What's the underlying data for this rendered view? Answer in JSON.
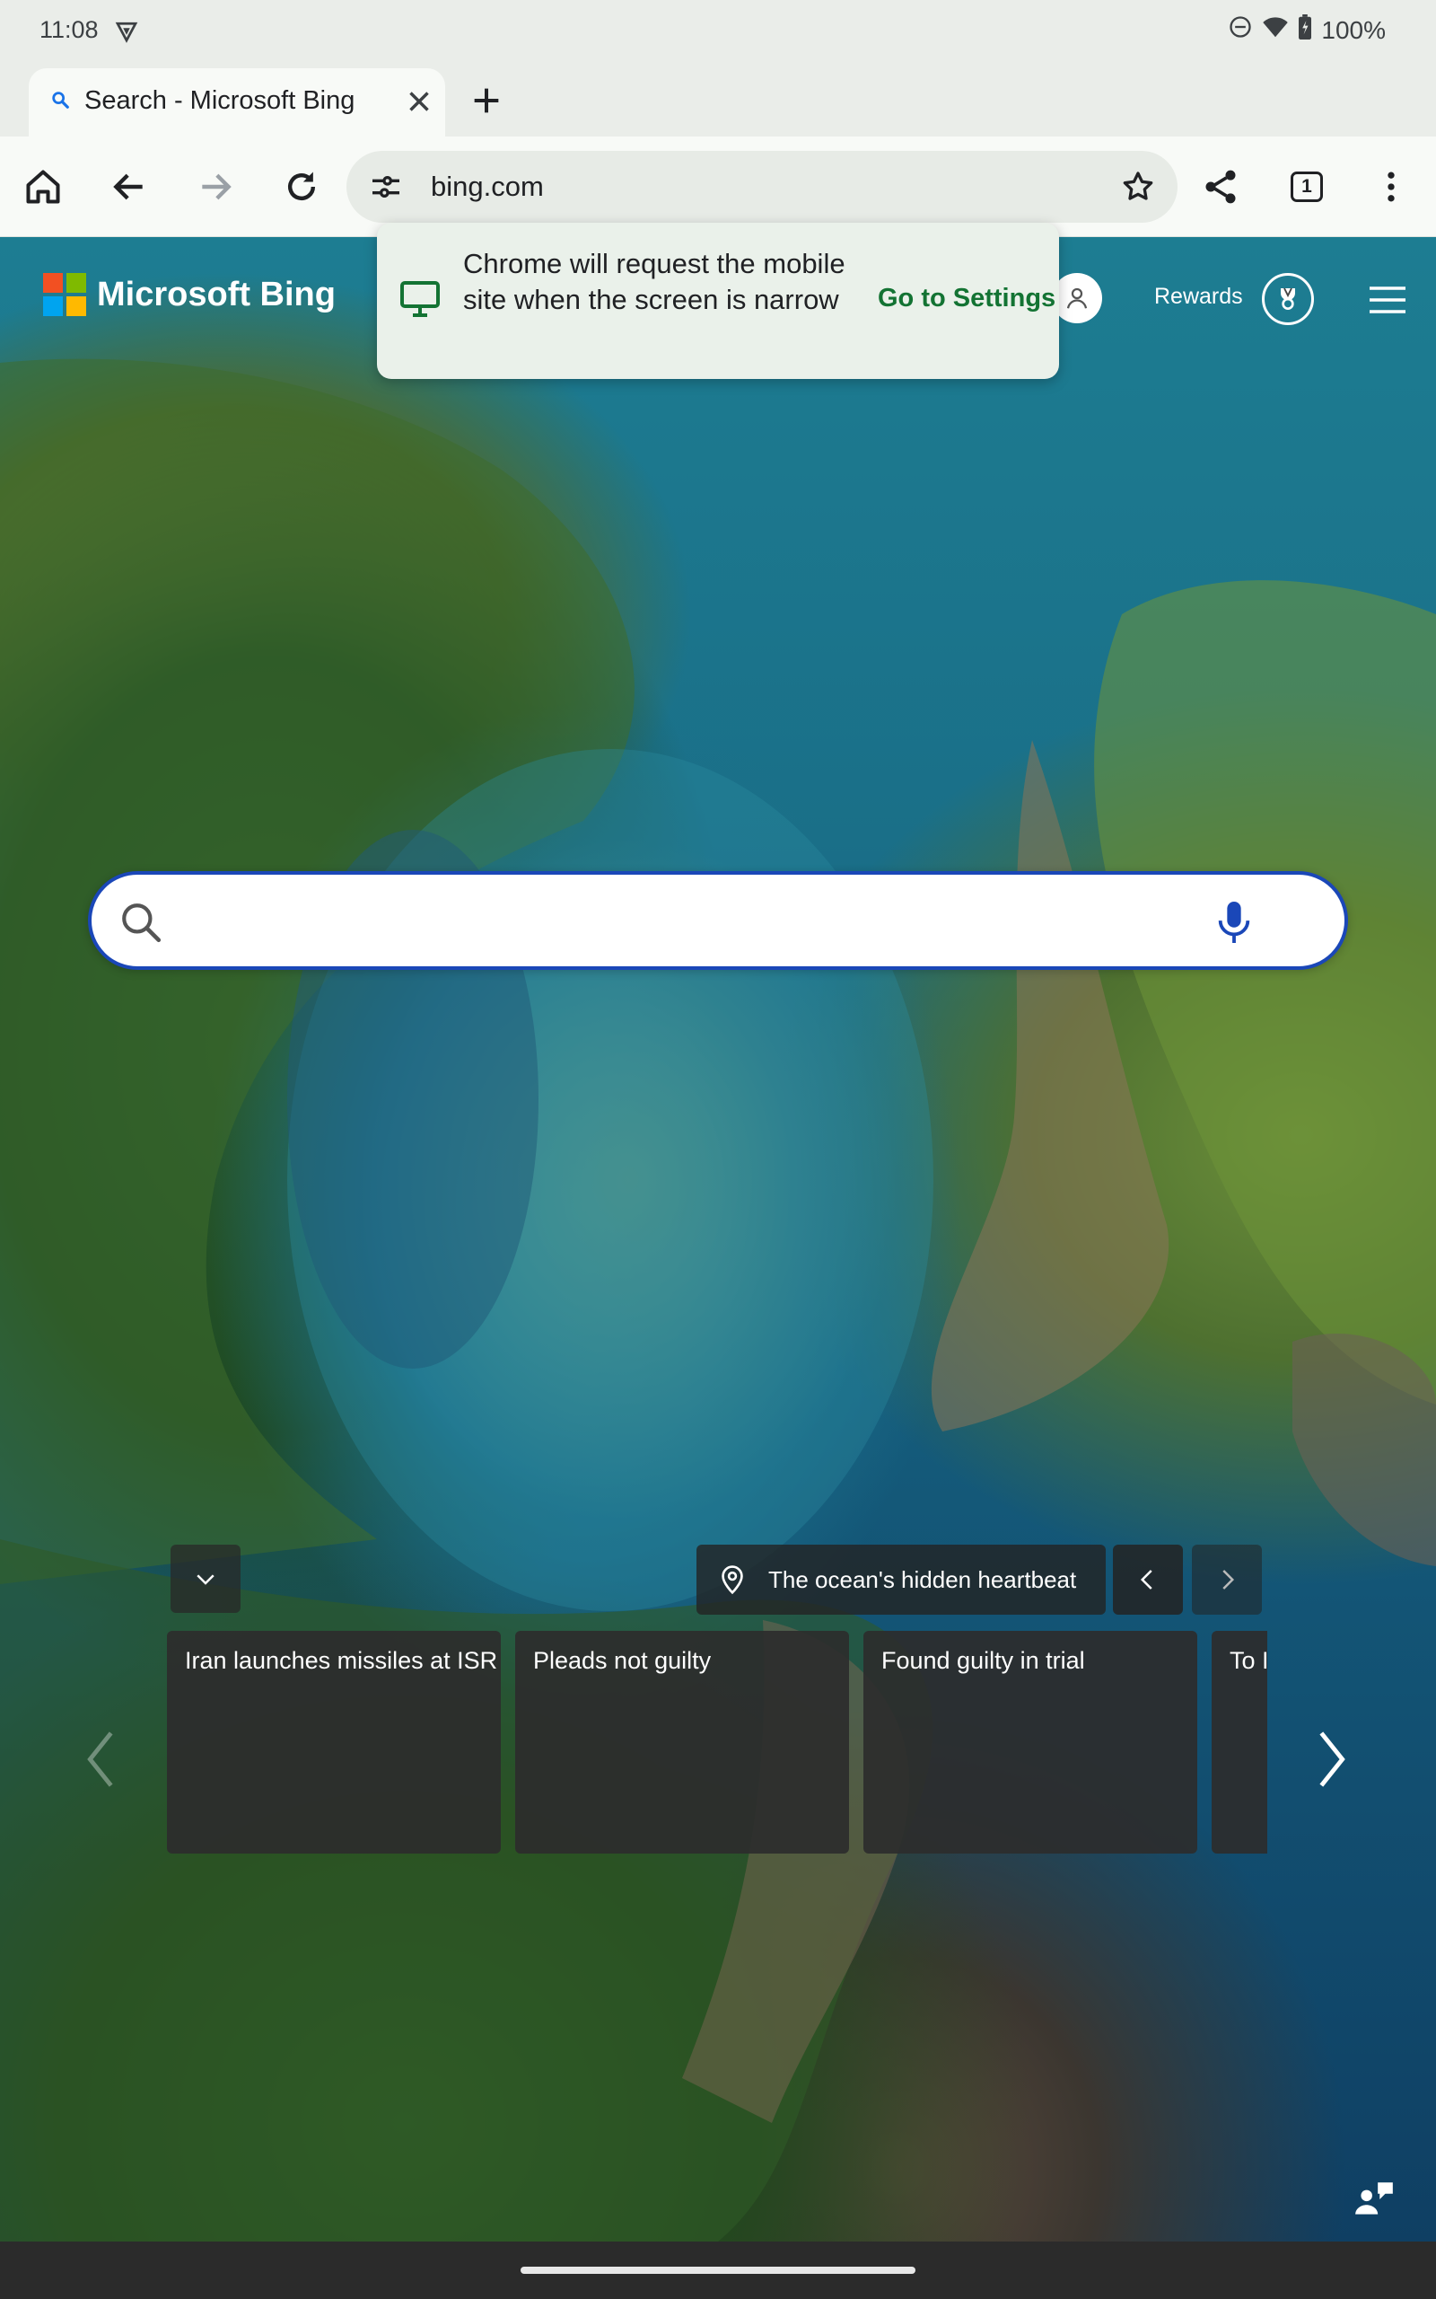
{
  "status": {
    "time": "11:08",
    "battery": "100%"
  },
  "tab": {
    "title": "Search - Microsoft Bing",
    "count": "1"
  },
  "omnibox": {
    "url": "bing.com"
  },
  "popup": {
    "message": "Chrome will request the mobile site when the screen is narrow",
    "action": "Go to Settings"
  },
  "bing": {
    "brand": "Microsoft Bing",
    "rewards_label": "Rewards"
  },
  "search": {
    "placeholder": ""
  },
  "image_caption": "The ocean's hidden heartbeat",
  "news_cards": [
    {
      "title": "Iran launches missiles at ISR"
    },
    {
      "title": "Pleads not guilty"
    },
    {
      "title": "Found guilty in trial"
    },
    {
      "title": "To I"
    }
  ],
  "colors": {
    "bing_search_border": "#1a47b8",
    "settings_link": "#137333",
    "chrome_surface": "#f8faf7"
  }
}
